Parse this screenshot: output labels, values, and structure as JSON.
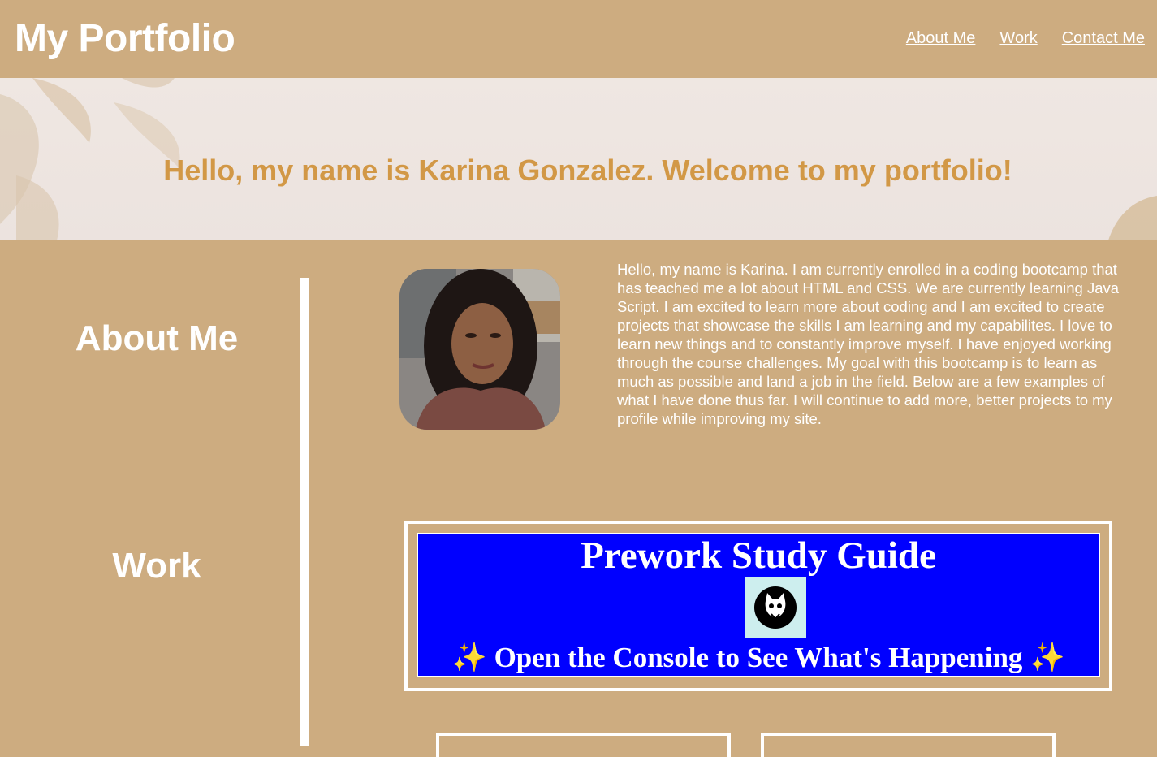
{
  "header": {
    "brand": "My Portfolio",
    "nav": [
      "About Me",
      "Work",
      "Contact Me"
    ]
  },
  "hero": {
    "title": "Hello, my name is Karina Gonzalez. Welcome to my portfolio!"
  },
  "sections": {
    "about_title": "About Me",
    "work_title": "Work"
  },
  "about": {
    "bio": "Hello, my name is Karina. I am currently enrolled in a coding bootcamp that has teached me a lot about HTML and CSS. We are currently learning Java Script. I am excited to learn more about coding and I am excited to create projects that showcase the skills I am learning and my capabilites. I love to learn new things and to constantly improve myself. I have enjoyed working through the course challenges. My goal with this bootcamp is to learn as much as possible and land a job in the field. Below are a few examples of what I have done thus far. I will continue to add more, better projects to my profile while improving my site."
  },
  "work": {
    "project_title": "Prework Study Guide",
    "project_subtitle": "Open the Console to See What's Happening",
    "sparkle": "✨"
  },
  "colors": {
    "background": "#cdac80",
    "hero_text": "#d29846",
    "project_bg": "#0000ff"
  }
}
